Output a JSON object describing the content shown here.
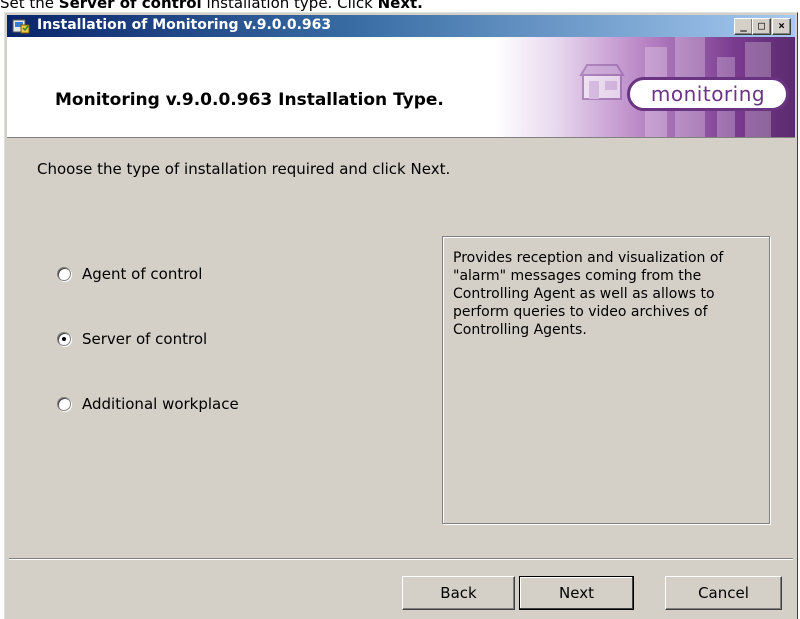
{
  "caption": {
    "prefix": "Set the ",
    "bold1": "Server of control",
    "middle": " installation type. Click ",
    "bold2": "Next."
  },
  "window": {
    "title": "Installation of Monitoring v.9.0.0.963",
    "minimize": "_",
    "maximize": "□",
    "close": "×"
  },
  "header": {
    "title": "Monitoring v.9.0.0.963 Installation Type.",
    "logo_text": "monitoring"
  },
  "body": {
    "instruction": "Choose the type of installation required and click Next.",
    "options": [
      {
        "label": "Agent of control",
        "selected": false
      },
      {
        "label": "Server of control",
        "selected": true
      },
      {
        "label": "Additional workplace",
        "selected": false
      }
    ],
    "description": "Provides reception and visualization of \"alarm\" messages coming from the Controlling Agent as well as allows to perform queries to video archives of Controlling Agents."
  },
  "buttons": {
    "back": "Back",
    "next": "Next",
    "cancel": "Cancel"
  },
  "colors": {
    "dialog_bg": "#d4d0c8",
    "title_start": "#0a246a",
    "title_end": "#a6caf0",
    "brand_purple": "#6a3483"
  }
}
